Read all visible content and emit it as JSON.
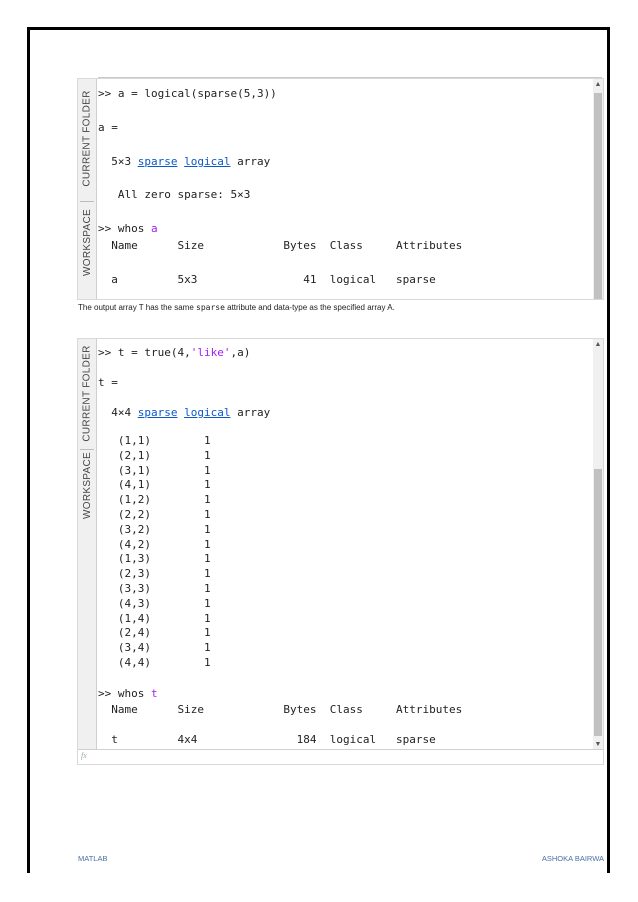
{
  "panel1": {
    "tabs": [
      "CURRENT FOLDER",
      "WORKSPACE"
    ],
    "lines": {
      "cmd": ">> a = logical(sparse(5,3))",
      "assign": "a =",
      "desc_prefix": "  5×3 ",
      "desc_link1": "sparse",
      "desc_link2": "logical",
      "desc_suffix": " array",
      "allzero": "   All zero sparse: 5×3",
      "whos_prefix": ">> whos ",
      "whos_arg": "a",
      "header": "  Name      Size            Bytes  Class     Attributes",
      "row": "  a         5x3                41  logical   sparse"
    }
  },
  "caption": {
    "before": "The output array T has the same ",
    "code": "sparse",
    "after": " attribute and data-type as the specified array A."
  },
  "panel2": {
    "tabs": [
      "CURRENT FOLDER",
      "WORKSPACE"
    ],
    "lines": {
      "cmd_prefix": ">> t = true(4,",
      "cmd_str": "'like'",
      "cmd_suffix": ",a)",
      "assign": "t =",
      "desc_prefix": "  4×4 ",
      "desc_link1": "sparse",
      "desc_link2": "logical",
      "desc_suffix": " array",
      "entries": [
        "   (1,1)        1",
        "   (2,1)        1",
        "   (3,1)        1",
        "   (4,1)        1",
        "   (1,2)        1",
        "   (2,2)        1",
        "   (3,2)        1",
        "   (4,2)        1",
        "   (1,3)        1",
        "   (2,3)        1",
        "   (3,3)        1",
        "   (4,3)        1",
        "   (1,4)        1",
        "   (2,4)        1",
        "   (3,4)        1",
        "   (4,4)        1"
      ],
      "whos_prefix": ">> whos ",
      "whos_arg": "t",
      "header": "  Name      Size            Bytes  Class     Attributes",
      "row": "  t         4x4               184  logical   sparse"
    },
    "prompt_glyph": "fx"
  },
  "footer": {
    "left": "MATLAB",
    "right": "ASHOKA BAIRWA"
  },
  "colors": {
    "keyword": "#a020f0",
    "link": "#0b58c9",
    "footer": "#4a6fa5"
  }
}
